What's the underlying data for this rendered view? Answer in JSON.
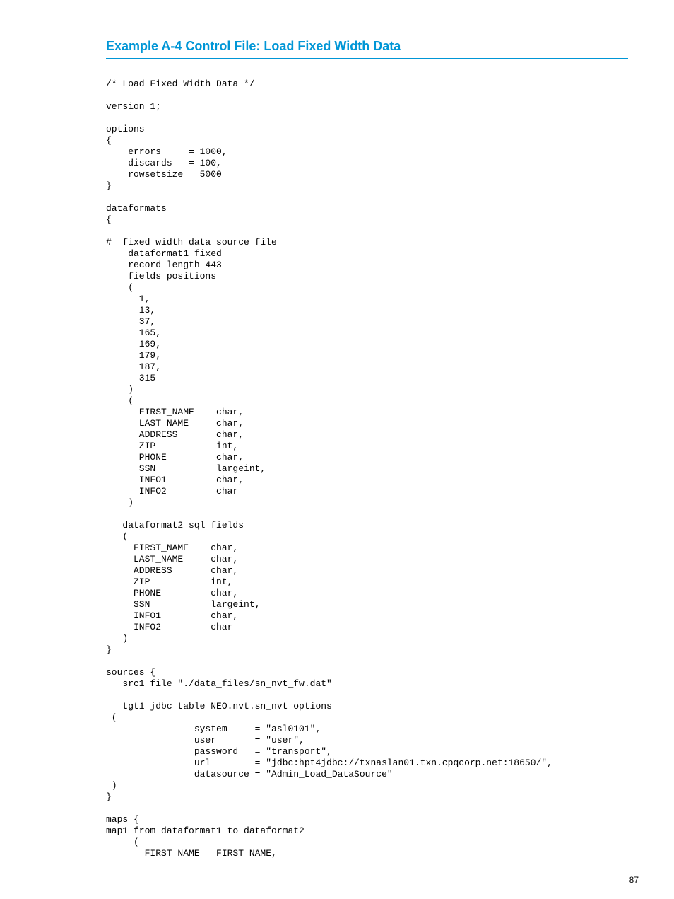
{
  "heading": "Example A-4 Control File: Load Fixed Width Data",
  "code": "/* Load Fixed Width Data */\n\nversion 1;\n\noptions\n{\n    errors     = 1000,\n    discards   = 100,\n    rowsetsize = 5000\n}\n\ndataformats\n{\n\n#  fixed width data source file\n    dataformat1 fixed\n    record length 443\n    fields positions\n    (\n      1,\n      13,\n      37,\n      165,\n      169,\n      179,\n      187,\n      315\n    )\n    (\n      FIRST_NAME    char,\n      LAST_NAME     char,\n      ADDRESS       char,\n      ZIP           int,\n      PHONE         char,\n      SSN           largeint,\n      INFO1         char,\n      INFO2         char\n    )\n\n   dataformat2 sql fields\n   (\n     FIRST_NAME    char,\n     LAST_NAME     char,\n     ADDRESS       char,\n     ZIP           int,\n     PHONE         char,\n     SSN           largeint,\n     INFO1         char,\n     INFO2         char\n   )\n}\n\nsources {\n   src1 file \"./data_files/sn_nvt_fw.dat\"\n\n   tgt1 jdbc table NEO.nvt.sn_nvt options\n (\n                system     = \"asl0101\",\n                user       = \"user\",\n                password   = \"transport\",\n                url        = \"jdbc:hpt4jdbc://txnaslan01.txn.cpqcorp.net:18650/\",\n                datasource = \"Admin_Load_DataSource\"\n )\n}\n\nmaps {\nmap1 from dataformat1 to dataformat2\n     (\n       FIRST_NAME = FIRST_NAME,",
  "page_number": "87"
}
